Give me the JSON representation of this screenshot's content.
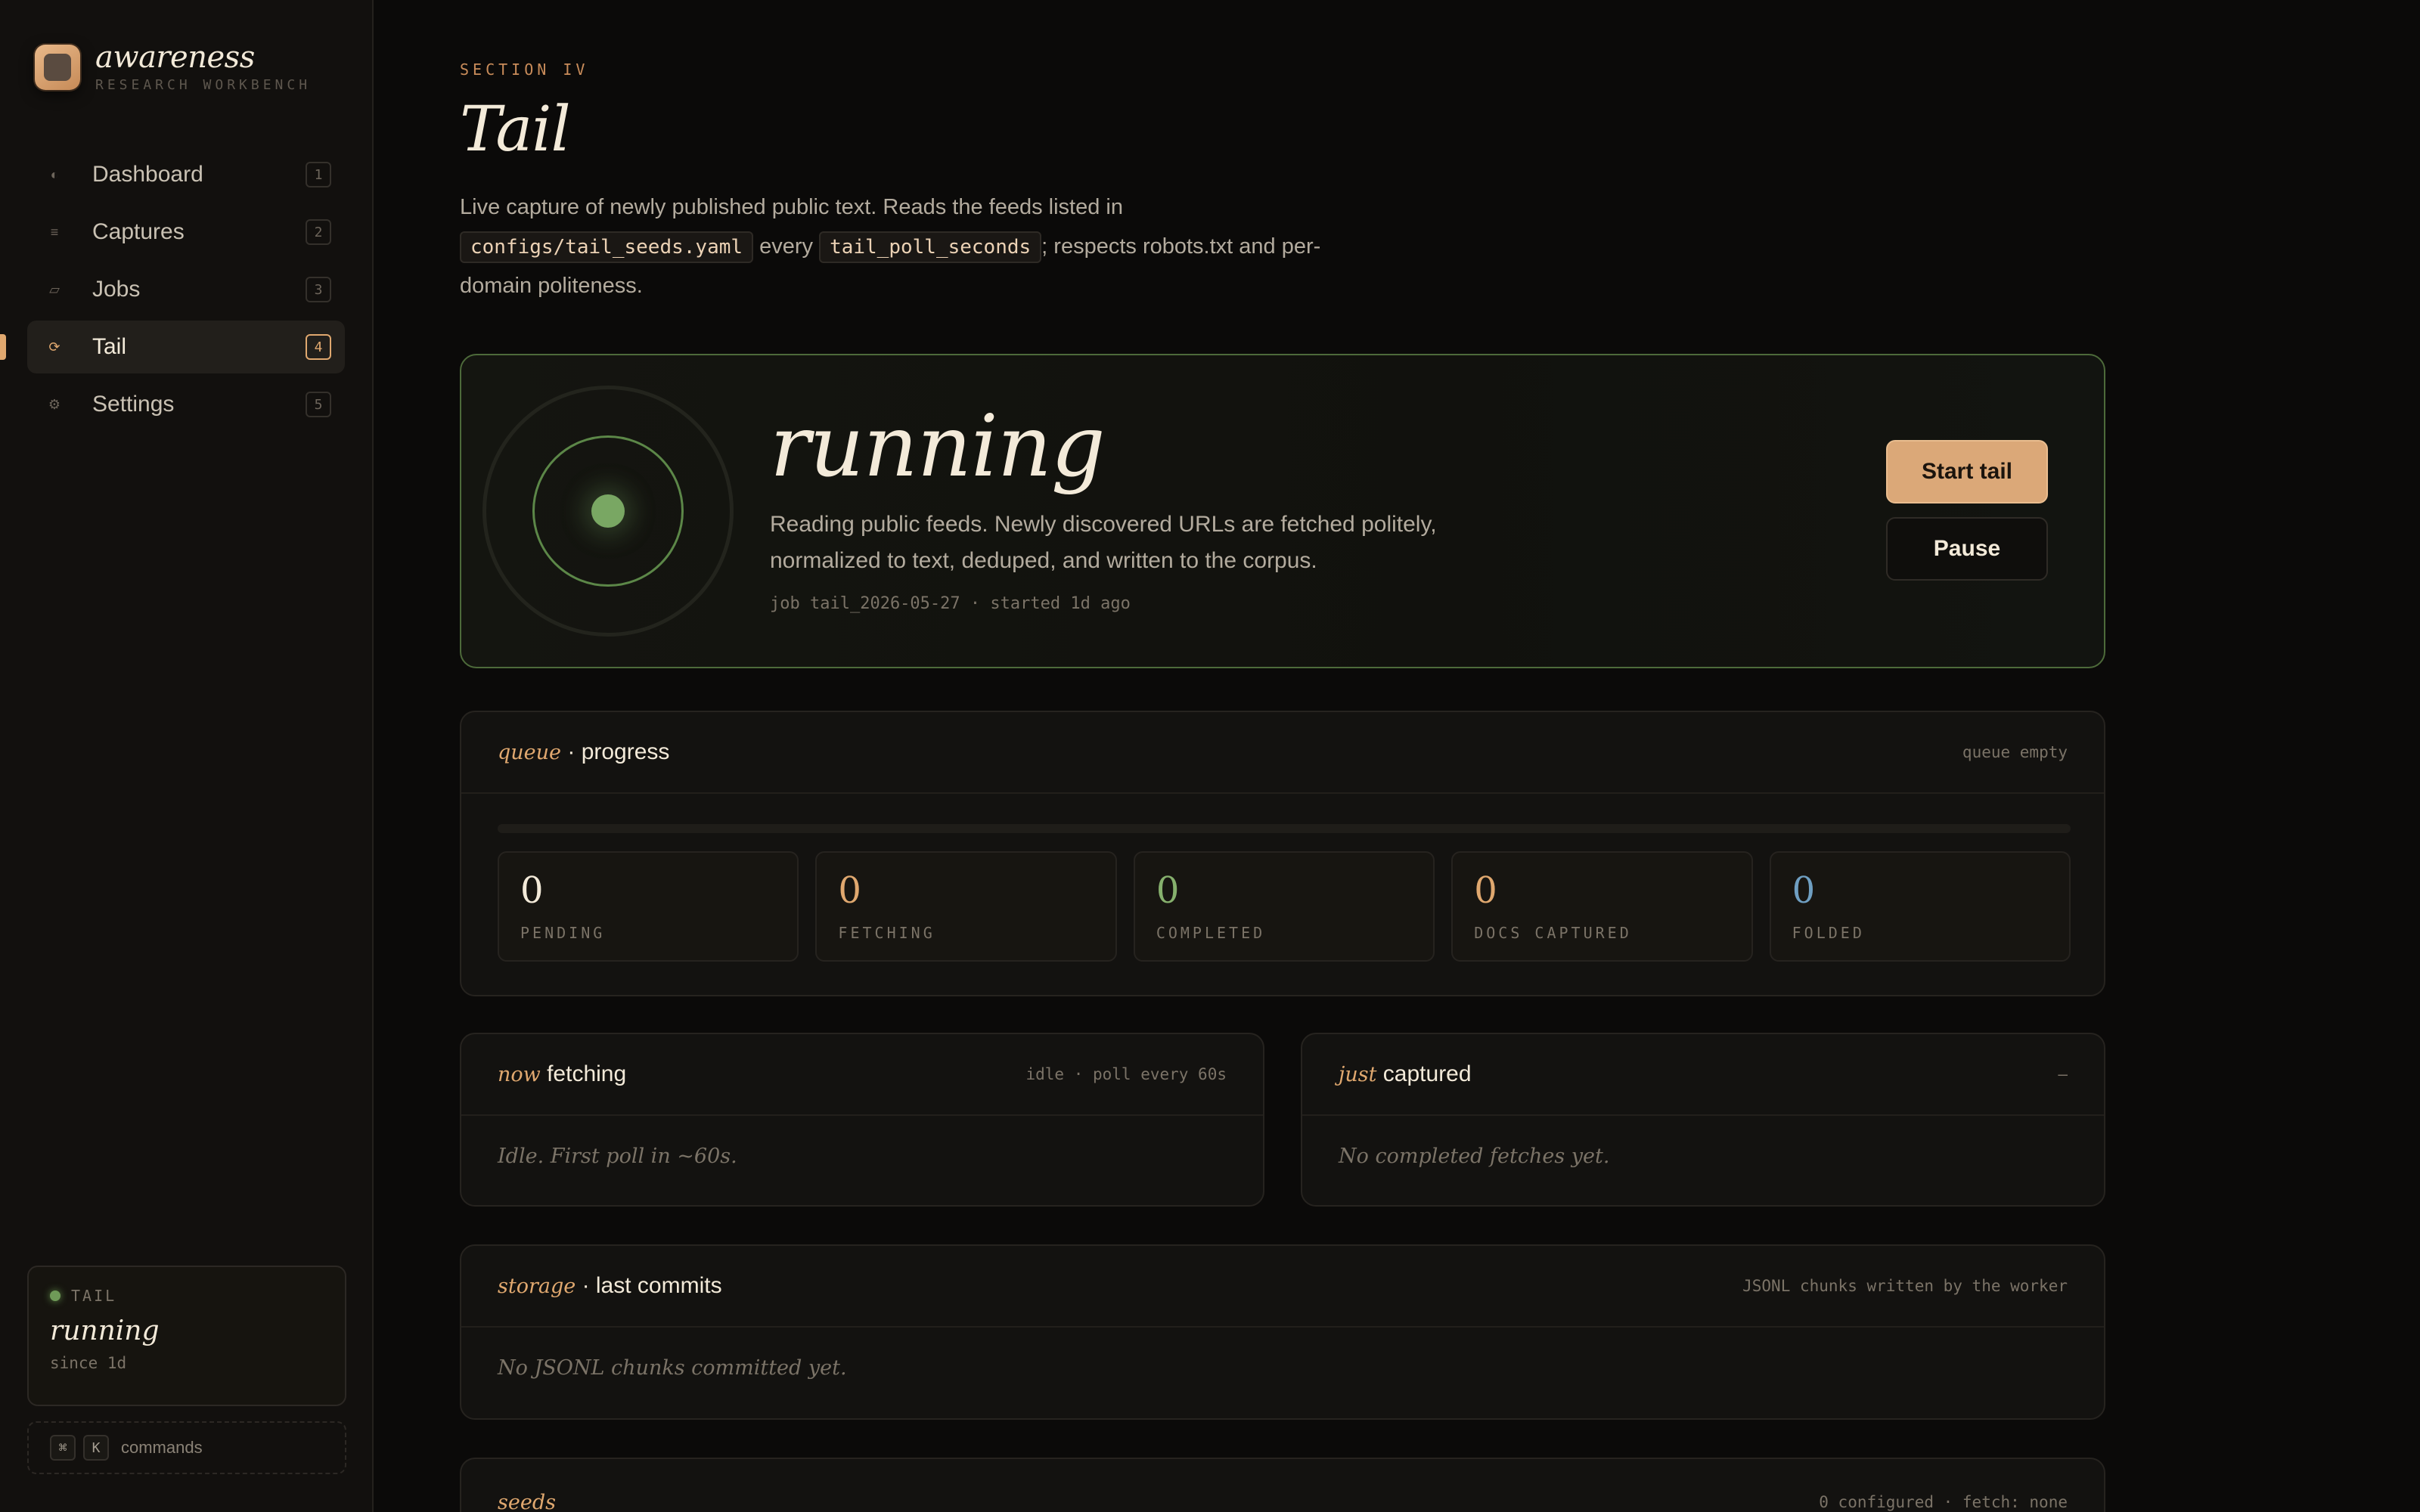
{
  "brand": {
    "name": "awareness",
    "subtitle": "RESEARCH WORKBENCH"
  },
  "nav": [
    {
      "label": "Dashboard",
      "key": "1",
      "icon": "half-circle-icon",
      "glyph": "◐"
    },
    {
      "label": "Captures",
      "key": "2",
      "icon": "lines-icon",
      "glyph": "≡"
    },
    {
      "label": "Jobs",
      "key": "3",
      "icon": "parallelogram-icon",
      "glyph": "▱"
    },
    {
      "label": "Tail",
      "key": "4",
      "icon": "cycle-icon",
      "glyph": "⟳",
      "active": true
    },
    {
      "label": "Settings",
      "key": "5",
      "icon": "gear-icon",
      "glyph": "⚙"
    }
  ],
  "sidebar_status": {
    "tag": "TAIL",
    "state": "running",
    "since": "since 1d"
  },
  "command_bar": {
    "keys": [
      "⌘",
      "K"
    ],
    "label": "commands"
  },
  "page": {
    "eyebrow": "SECTION IV",
    "title": "Tail",
    "desc_1": "Live capture of newly published public text. Reads the feeds listed in",
    "desc_code_1": "configs/tail_seeds.yaml",
    "desc_2": " every ",
    "desc_code_2": "tail_poll_seconds",
    "desc_3": "; respects robots.txt and per-domain politeness."
  },
  "hero": {
    "state": "running",
    "text": "Reading public feeds. Newly discovered URLs are fetched politely, normalized to text, deduped, and written to the corpus.",
    "meta": "job tail_2026-05-27 · started 1d ago",
    "start_label": "Start tail",
    "pause_label": "Pause"
  },
  "queue": {
    "title_em": "queue",
    "title": " · progress",
    "meta": "queue empty",
    "progress": 0,
    "stats": [
      {
        "value": "0",
        "label": "PENDING",
        "color": "#f3ead9"
      },
      {
        "value": "0",
        "label": "FETCHING",
        "color": "#e0a86f"
      },
      {
        "value": "0",
        "label": "COMPLETED",
        "color": "#86b06d"
      },
      {
        "value": "0",
        "label": "DOCS CAPTURED",
        "color": "#e0a86f"
      },
      {
        "value": "0",
        "label": "FOLDED",
        "color": "#6f9fc2"
      }
    ]
  },
  "fetching": {
    "title_em": "now",
    "title": " fetching",
    "meta": "idle · poll every 60s",
    "empty": "Idle. First poll in ~60s."
  },
  "captured": {
    "title_em": "just",
    "title": " captured",
    "meta": "–",
    "empty": "No completed fetches yet."
  },
  "storage": {
    "title_em": "storage",
    "title": " · last commits",
    "meta": "JSONL chunks written by the worker",
    "empty": "No JSONL chunks committed yet."
  },
  "seeds": {
    "title_em": "seeds",
    "title": "",
    "meta": "0 configured · fetch: none"
  },
  "colors": {
    "accent": "#e0a86f",
    "running": "#79a763",
    "hero_border": "#4d6a3a"
  }
}
